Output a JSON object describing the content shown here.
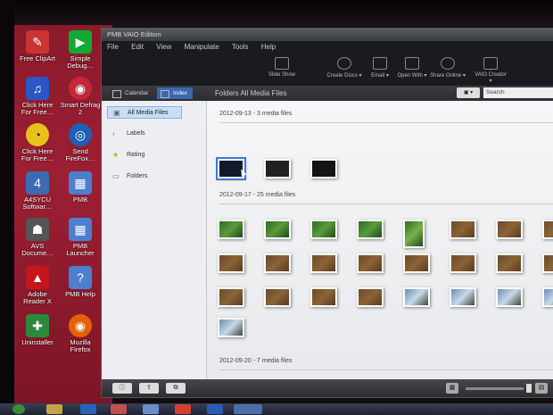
{
  "desktop_icons": [
    {
      "label": "Free ClipArt"
    },
    {
      "label": "Simple Debug…"
    },
    {
      "label": "Click Here\nFor Free…"
    },
    {
      "label": "Smart Defrag\n2"
    },
    {
      "label": "Click Here\nFor Free…"
    },
    {
      "label": "Send\nFireFox…"
    },
    {
      "label": "A4SYCU\nSoftwar…"
    },
    {
      "label": "PMB"
    },
    {
      "label": "AVS\nDocume…"
    },
    {
      "label": "PMB\nLauncher"
    },
    {
      "label": "Adobe\nReader X"
    },
    {
      "label": "PMB Help"
    },
    {
      "label": "Uninstaller"
    },
    {
      "label": "Mozilla\nFirefox"
    }
  ],
  "app": {
    "title": "PMB VAIO Edition",
    "menu": [
      "File",
      "Edit",
      "View",
      "Manipulate",
      "Tools",
      "Help"
    ],
    "toolbar": [
      {
        "label": "Slide Show",
        "icon": "slideshow-icon"
      },
      {
        "label": "Create Discs ▾",
        "icon": "disc-icon"
      },
      {
        "label": "Email ▾",
        "icon": "email-icon"
      },
      {
        "label": "Open With ▾",
        "icon": "open-with-icon"
      },
      {
        "label": "Share Online ▾",
        "icon": "share-icon"
      },
      {
        "label": "VAIO Creator ▾",
        "icon": "creator-icon"
      }
    ],
    "view_tabs": [
      "Calendar",
      "Index"
    ],
    "breadcrumb": "Folders  All Media Files",
    "search_placeholder": "Search",
    "sidebar": [
      "All Media Files",
      "Labels",
      "Rating",
      "Folders"
    ],
    "groups": [
      {
        "date": "2012-09-13",
        "count_text": "- 3 media files"
      },
      {
        "date": "2012-09-17",
        "count_text": "- 25 media files"
      },
      {
        "date": "2012-09-20",
        "count_text": "- 7 media files"
      }
    ]
  },
  "colors": {
    "accent": "#3a67b0",
    "desktop": "#9d1f33",
    "selection": "#3b78d6"
  }
}
